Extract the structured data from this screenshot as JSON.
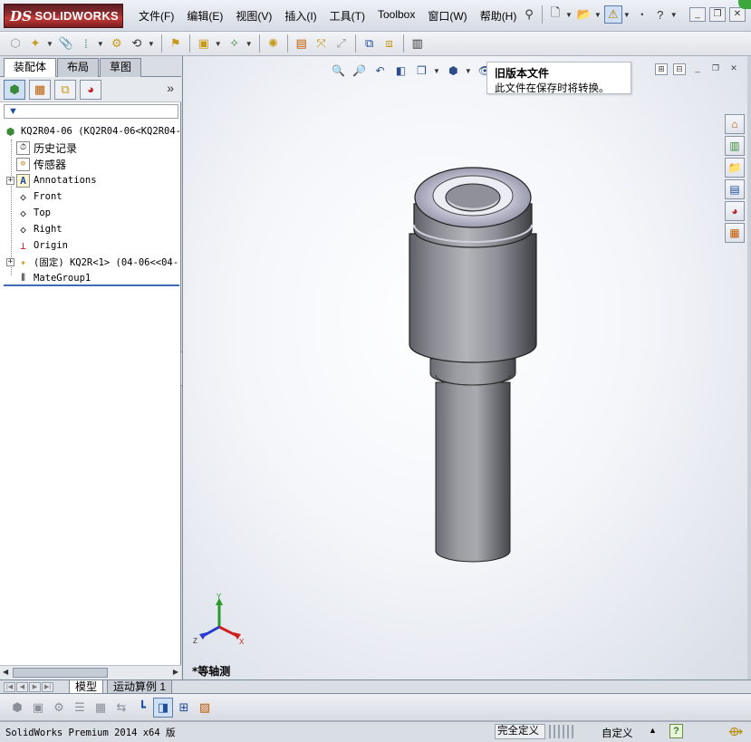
{
  "app": {
    "brand": "SOLIDWORKS",
    "brand_prefix": "DS"
  },
  "menu": [
    "文件(F)",
    "编辑(E)",
    "视图(V)",
    "插入(I)",
    "工具(T)",
    "Toolbox",
    "窗口(W)",
    "帮助(H)"
  ],
  "panel_tabs": [
    "装配体",
    "布局",
    "草图"
  ],
  "tree": {
    "root": "KQ2R04-06  (KQ2R04-06<KQ2R04-",
    "history": "历史记录",
    "sensors": "传感器",
    "annotations": "Annotations",
    "front": "Front",
    "top": "Top",
    "right": "Right",
    "origin": "Origin",
    "component": "(固定) KQ2R<1> (04-06<<04-",
    "mategroup": "MateGroup1"
  },
  "tooltip": {
    "title": "旧版本文件",
    "body": "此文件在保存时将转换。"
  },
  "viewport": {
    "view_name": "*等轴测",
    "axis_x": "X",
    "axis_y": "Y",
    "axis_z": "Z"
  },
  "bottom_tabs": [
    "模型",
    "运动算例 1"
  ],
  "status": {
    "text": "SolidWorks Premium 2014 x64 版",
    "definition": "完全定义",
    "units": "自定义",
    "help": "?"
  },
  "icons": {
    "colors": {
      "accent": "#1d4e9e",
      "brand": "#8e2a2e",
      "triad_x": "#d02020",
      "triad_y": "#2a9a2a",
      "triad_z": "#2a3ad0"
    }
  }
}
